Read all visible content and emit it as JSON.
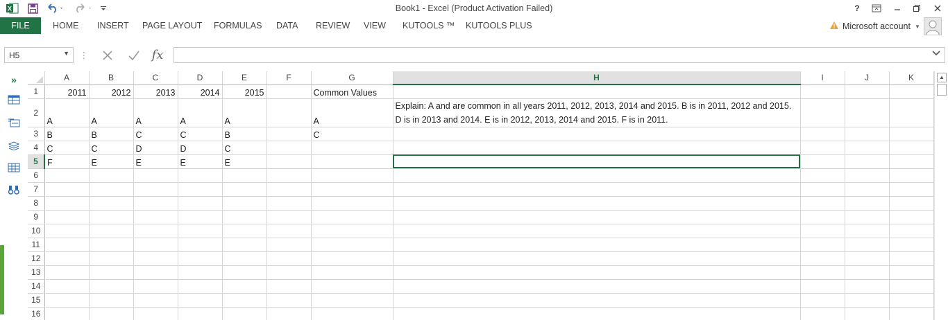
{
  "app": {
    "title": "Book1 - Excel (Product Activation Failed)",
    "accent_color": "#217346"
  },
  "quick_access": {
    "icons": [
      "excel-logo-icon",
      "save-icon",
      "undo-icon",
      "redo-icon",
      "customize-icon"
    ]
  },
  "window_controls": {
    "help": "?",
    "icons": [
      "help-icon",
      "ribbon-display-icon",
      "minimize-icon",
      "restore-icon",
      "close-icon"
    ]
  },
  "ribbon": {
    "file": "FILE",
    "tabs": [
      "HOME",
      "INSERT",
      "PAGE LAYOUT",
      "FORMULAS",
      "DATA",
      "REVIEW",
      "VIEW",
      "KUTOOLS ™",
      "KUTOOLS PLUS"
    ],
    "account": "Microsoft account"
  },
  "formula_bar": {
    "name_box": "H5",
    "fx": "fx",
    "content": ""
  },
  "columns": [
    "A",
    "B",
    "C",
    "D",
    "E",
    "F",
    "G",
    "H",
    "I",
    "J",
    "K"
  ],
  "selected_column": "H",
  "selected_row": "5",
  "rows": [
    {
      "num": "1",
      "cells": [
        "2011",
        "2012",
        "2013",
        "2014",
        "2015",
        "",
        "Common Values",
        "",
        "",
        "",
        ""
      ]
    },
    {
      "num": "2",
      "cells": [
        "A",
        "A",
        "A",
        "A",
        "A",
        "",
        "A",
        "Explain:  A and are common in all years 2011, 2012, 2013, 2014 and 2015. B is in 2011, 2012 and 2015. D is in 2013 and 2014. E is in 2012, 2013, 2014 and  2015. F is in 2011.",
        "",
        "",
        ""
      ]
    },
    {
      "num": "3",
      "cells": [
        "B",
        "B",
        "C",
        "C",
        "B",
        "",
        "C",
        "",
        "",
        "",
        ""
      ]
    },
    {
      "num": "4",
      "cells": [
        "C",
        "C",
        "D",
        "D",
        "C",
        "",
        "",
        "",
        "",
        "",
        ""
      ]
    },
    {
      "num": "5",
      "cells": [
        "F",
        "E",
        "E",
        "E",
        "E",
        "",
        "",
        "",
        "",
        "",
        ""
      ]
    },
    {
      "num": "6",
      "cells": [
        "",
        "",
        "",
        "",
        "",
        "",
        "",
        "",
        "",
        "",
        ""
      ]
    },
    {
      "num": "7",
      "cells": [
        "",
        "",
        "",
        "",
        "",
        "",
        "",
        "",
        "",
        "",
        ""
      ]
    },
    {
      "num": "8",
      "cells": [
        "",
        "",
        "",
        "",
        "",
        "",
        "",
        "",
        "",
        "",
        ""
      ]
    },
    {
      "num": "9",
      "cells": [
        "",
        "",
        "",
        "",
        "",
        "",
        "",
        "",
        "",
        "",
        ""
      ]
    },
    {
      "num": "10",
      "cells": [
        "",
        "",
        "",
        "",
        "",
        "",
        "",
        "",
        "",
        "",
        ""
      ]
    },
    {
      "num": "11",
      "cells": [
        "",
        "",
        "",
        "",
        "",
        "",
        "",
        "",
        "",
        "",
        ""
      ]
    },
    {
      "num": "12",
      "cells": [
        "",
        "",
        "",
        "",
        "",
        "",
        "",
        "",
        "",
        "",
        ""
      ]
    },
    {
      "num": "13",
      "cells": [
        "",
        "",
        "",
        "",
        "",
        "",
        "",
        "",
        "",
        "",
        ""
      ]
    },
    {
      "num": "14",
      "cells": [
        "",
        "",
        "",
        "",
        "",
        "",
        "",
        "",
        "",
        "",
        ""
      ]
    },
    {
      "num": "15",
      "cells": [
        "",
        "",
        "",
        "",
        "",
        "",
        "",
        "",
        "",
        "",
        ""
      ]
    },
    {
      "num": "16",
      "cells": [
        "",
        "",
        "",
        "",
        "",
        "",
        "",
        "",
        "",
        "",
        ""
      ]
    }
  ]
}
